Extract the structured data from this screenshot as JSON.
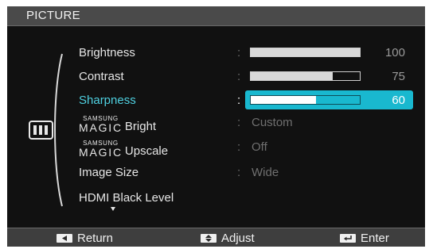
{
  "title": "PICTURE",
  "menu": {
    "items": [
      {
        "label": "Brightness",
        "type": "slider",
        "value": 100
      },
      {
        "label": "Contrast",
        "type": "slider",
        "value": 75
      },
      {
        "label": "Sharpness",
        "type": "slider",
        "value": 60,
        "selected": true
      },
      {
        "brand": "SAMSUNG",
        "magic": "MAGIC",
        "label": "Bright",
        "type": "option",
        "value": "Custom"
      },
      {
        "brand": "SAMSUNG",
        "magic": "MAGIC",
        "label": "Upscale",
        "type": "option",
        "value": "Off"
      },
      {
        "label": "Image Size",
        "type": "option",
        "value": "Wide"
      },
      {
        "label": "HDMI Black Level",
        "type": "option",
        "value": ""
      }
    ],
    "separator": ":"
  },
  "footer": {
    "return_label": "Return",
    "adjust_label": "Adjust",
    "enter_label": "Enter"
  },
  "colors": {
    "highlight": "#19b8cf",
    "selected_text": "#4fd0e0",
    "background": "#111111"
  },
  "icons": {
    "category": "picture-category-icon",
    "return": "left-arrow-key-icon",
    "adjust": "up-down-arrow-key-icon",
    "enter": "enter-key-icon",
    "more": "scroll-down-arrow-icon"
  }
}
